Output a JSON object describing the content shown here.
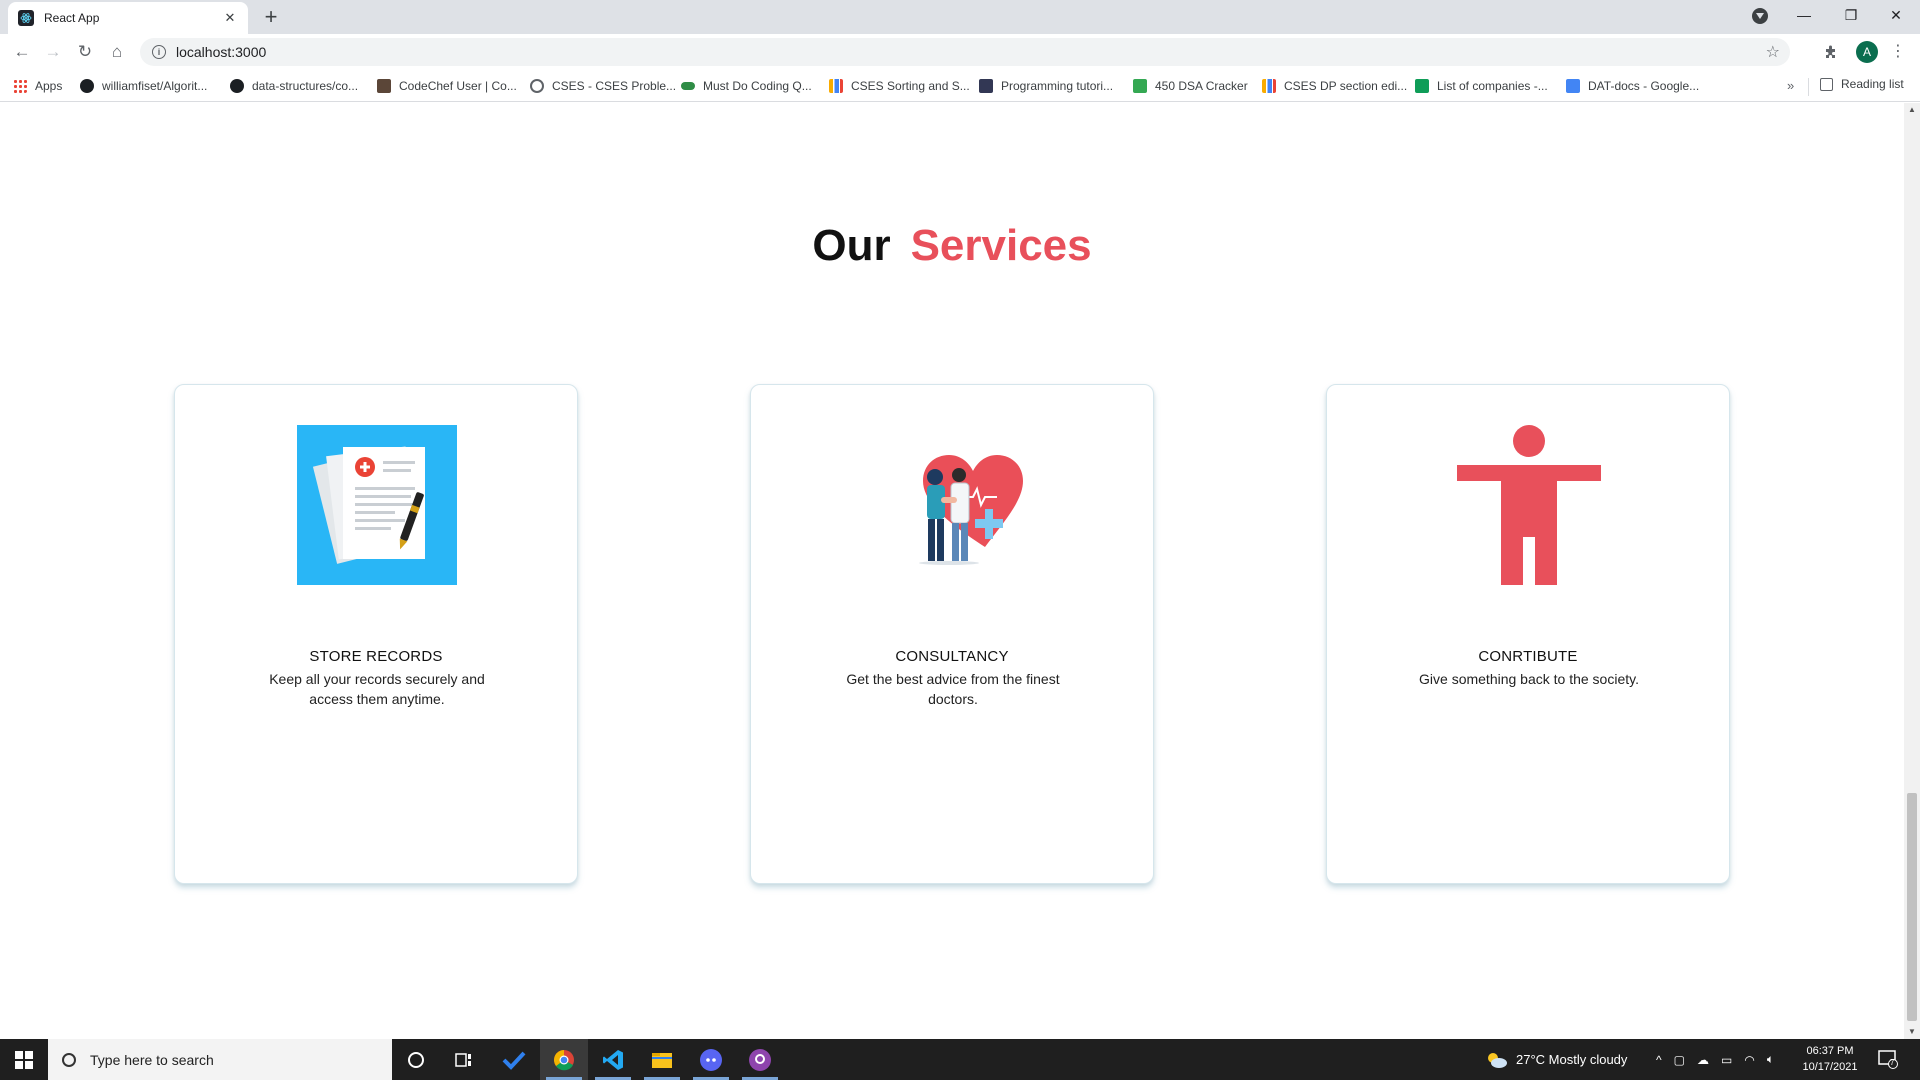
{
  "browser": {
    "tab_title": "React App",
    "url": "localhost:3000",
    "avatar_letter": "A",
    "bookmarks": [
      {
        "label": "Apps",
        "icon": "apps-grid-icon",
        "color": "#ea4335"
      },
      {
        "label": "williamfiset/Algorit...",
        "icon": "github-icon",
        "color": "#1b1f23"
      },
      {
        "label": "data-structures/co...",
        "icon": "github-icon",
        "color": "#1b1f23"
      },
      {
        "label": "CodeChef User | Co...",
        "icon": "codechef-icon",
        "color": "#5b4638"
      },
      {
        "label": "CSES - CSES Proble...",
        "icon": "globe-icon",
        "color": "#5f6368"
      },
      {
        "label": "Must Do Coding Q...",
        "icon": "gfg-icon",
        "color": "#2f8d46"
      },
      {
        "label": "CSES Sorting and S...",
        "icon": "chart-icon",
        "color": "#f9ab00"
      },
      {
        "label": "Programming tutori...",
        "icon": "hackerearth-icon",
        "color": "#323754"
      },
      {
        "label": "450 DSA Cracker",
        "icon": "four-icon",
        "color": "#34a853"
      },
      {
        "label": "CSES DP section edi...",
        "icon": "chart-icon",
        "color": "#f9ab00"
      },
      {
        "label": "List of companies -...",
        "icon": "sheets-icon",
        "color": "#0f9d58"
      },
      {
        "label": "DAT-docs - Google...",
        "icon": "docs-icon",
        "color": "#4285f4"
      }
    ],
    "more_label": "»",
    "reading_list": "Reading list"
  },
  "page": {
    "heading_word1": "Our",
    "heading_word2": "Services",
    "accent_color": "#e8505b",
    "cards": [
      {
        "title": "STORE RECORDS",
        "desc": "Keep all your records securely and access them anytime.",
        "icon": "medical-records-icon"
      },
      {
        "title": "CONSULTANCY",
        "desc": "Get the best advice from the finest doctors.",
        "icon": "doctor-consultation-icon"
      },
      {
        "title": "CONRTIBUTE",
        "desc": "Give something back to the society.",
        "icon": "person-contribute-icon"
      }
    ]
  },
  "taskbar": {
    "search_placeholder": "Type here to search",
    "weather": "27°C  Mostly cloudy",
    "time": "06:37 PM",
    "date": "10/17/2021",
    "notifications": "7"
  }
}
